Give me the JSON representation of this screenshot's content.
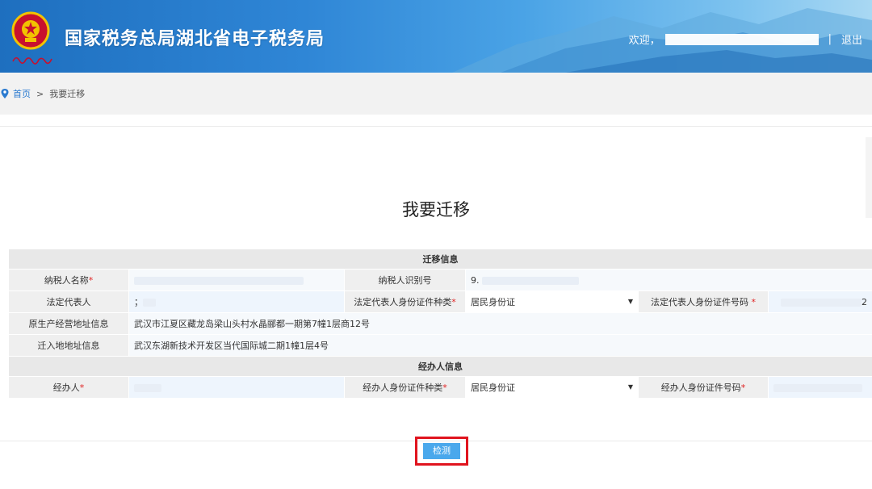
{
  "header": {
    "title": "国家税务总局湖北省电子税务局",
    "welcome": "欢迎，",
    "separator": "|",
    "logout": "退出"
  },
  "breadcrumb": {
    "home": "首页",
    "arrow": ">",
    "current": "我要迁移"
  },
  "page": {
    "title": "我要迁移"
  },
  "sections": {
    "migration": "迁移信息",
    "handler": "经办人信息"
  },
  "fields": {
    "taxpayer_name_label": "纳税人名称",
    "taxpayer_id_label": "纳税人识别号",
    "taxpayer_id_value": "9.",
    "legal_rep_label": "法定代表人",
    "legal_rep_value": "；",
    "legal_id_type_label": "法定代表人身份证件种类",
    "legal_id_type_value": "居民身份证",
    "legal_id_no_label": "法定代表人身份证件号码",
    "legal_id_no_value": "2",
    "orig_addr_label": "原生产经营地址信息",
    "orig_addr_value": "武汉市江夏区藏龙岛梁山头村水晶郦都一期第7幢1层商12号",
    "new_addr_label": "迁入地地址信息",
    "new_addr_value": "武汉东湖新技术开发区当代国际城二期1幢1层4号",
    "handler_label": "经办人",
    "handler_id_type_label": "经办人身份证件种类",
    "handler_id_type_value": "居民身份证",
    "handler_id_no_label": "经办人身份证件号码",
    "required_mark": "*"
  },
  "actions": {
    "check": "检测"
  },
  "colors": {
    "header_blue": "#2f86d6",
    "highlight_red": "#e0141e",
    "button_blue": "#4aa8ec",
    "required_red": "#e02222"
  },
  "icons": {
    "emblem": "tax-emblem-icon",
    "pin": "location-pin-icon",
    "dropdown": "dropdown-arrow-icon"
  }
}
